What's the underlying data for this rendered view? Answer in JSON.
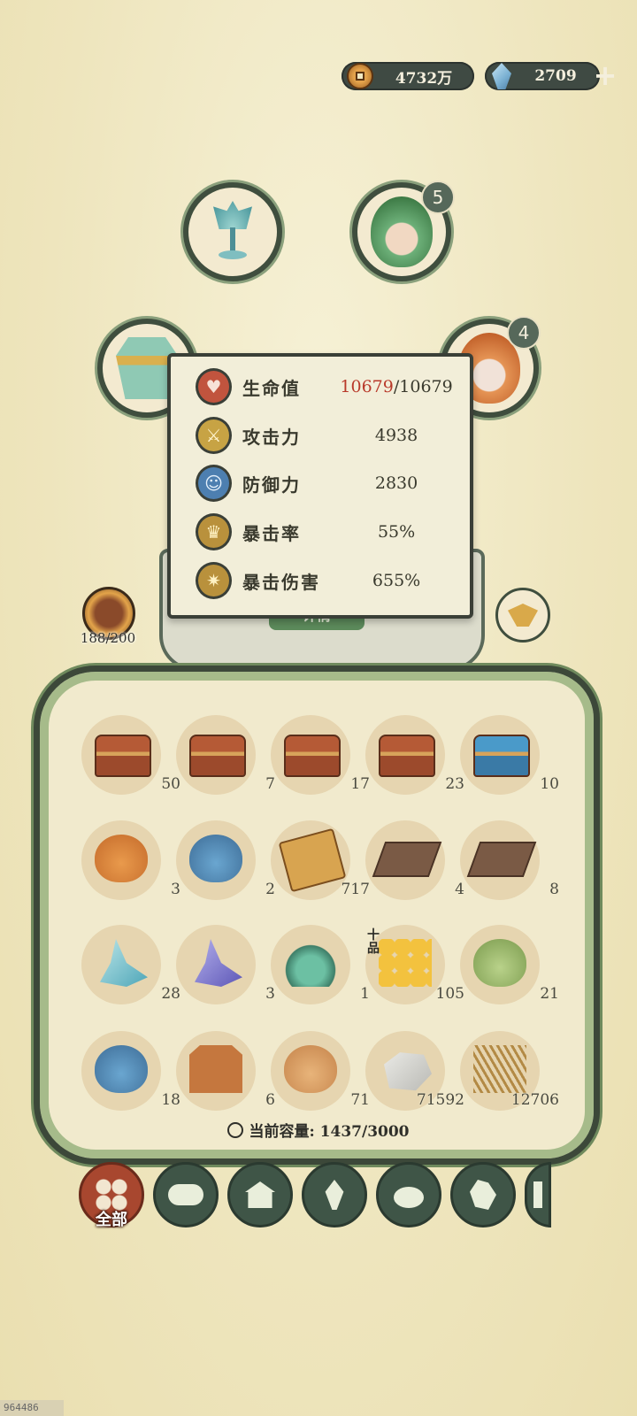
{
  "currency": {
    "coins": "4732万",
    "gems": "2709",
    "add_label": "+"
  },
  "equipment": {
    "green_badge": "5",
    "fire_badge": "4"
  },
  "details_button": "详情",
  "stats": [
    {
      "label": "生命值",
      "icon": "heart-icon",
      "value_current": "10679",
      "value_rest": "/10679"
    },
    {
      "label": "攻击力",
      "icon": "sword-icon",
      "value": "4938"
    },
    {
      "label": "防御力",
      "icon": "person-shield-icon",
      "value": "2830"
    },
    {
      "label": "暴击率",
      "icon": "crown-burst-icon",
      "value": "55%"
    },
    {
      "label": "暴击伤害",
      "icon": "spark-burst-icon",
      "value": "655%"
    }
  ],
  "level": {
    "text": "188/200"
  },
  "inventory": {
    "rows": [
      [
        {
          "icon": "treasure-chest-icon",
          "qty": "50"
        },
        {
          "icon": "treasure-chest-icon",
          "qty": "7"
        },
        {
          "icon": "treasure-chest-icon",
          "qty": "17"
        },
        {
          "icon": "treasure-chest-icon",
          "qty": "23"
        },
        {
          "icon": "blue-chest-icon",
          "qty": "10"
        }
      ],
      [
        {
          "icon": "orange-pouch-icon",
          "qty": "3"
        },
        {
          "icon": "blue-gift-bag-icon",
          "qty": "2"
        },
        {
          "icon": "scroll-icon",
          "qty": "717"
        },
        {
          "icon": "spoon-board-icon",
          "qty": "4"
        },
        {
          "icon": "spoon-board-icon",
          "qty": "8"
        }
      ],
      [
        {
          "icon": "cyan-fish-icon",
          "qty": "28"
        },
        {
          "icon": "purple-fish-icon",
          "qty": "3"
        },
        {
          "icon": "potion-flask-icon",
          "qty": "1"
        },
        {
          "icon": "golden-grapes-icon",
          "qty": "105"
        },
        {
          "icon": "green-pouch-icon",
          "qty": "21"
        }
      ],
      [
        {
          "icon": "blue-pouch-icon",
          "qty": "18"
        },
        {
          "icon": "wooden-tag-icon",
          "qty": "6"
        },
        {
          "icon": "tan-pouch-icon",
          "qty": "71"
        },
        {
          "icon": "stone-icon",
          "qty": "71592"
        },
        {
          "icon": "straw-bundle-icon",
          "qty": "12706"
        }
      ]
    ],
    "grade_tag": "十品",
    "capacity_label": "当前容量:",
    "capacity_value": "1437/3000"
  },
  "categories": {
    "active_label": "全部",
    "items": [
      "clover-icon",
      "log-icon",
      "house-icon",
      "sprout-icon",
      "rice-bowl-icon",
      "map-icon",
      "scroll-tab-icon"
    ]
  },
  "footer_id": "964486"
}
